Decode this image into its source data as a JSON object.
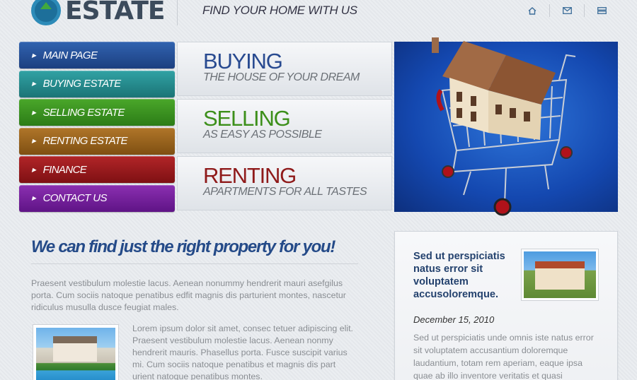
{
  "header": {
    "logo_text": "ESTATE",
    "tagline": "FIND YOUR HOME WITH US",
    "icons": [
      "home-icon",
      "mail-icon",
      "sitemap-icon"
    ]
  },
  "menu": {
    "items": [
      {
        "label": "MAIN PAGE",
        "color": "#2a569f"
      },
      {
        "label": "BUYING ESTATE",
        "color": "#279092"
      },
      {
        "label": "SELLING ESTATE",
        "color": "#3e9522"
      },
      {
        "label": "RENTING ESTATE",
        "color": "#9b651f"
      },
      {
        "label": "FINANCE",
        "color": "#9d1c1f"
      },
      {
        "label": "CONTACT US",
        "color": "#7b24a0"
      }
    ]
  },
  "promos": [
    {
      "title": "BUYING",
      "subtitle": "THE HOUSE OF YOUR DREAM",
      "color": "#284a90"
    },
    {
      "title": "SELLING",
      "subtitle": "AS EASY AS POSSIBLE",
      "color": "#3c8f1a"
    },
    {
      "title": "RENTING",
      "subtitle": "APARTMENTS FOR ALL TASTES",
      "color": "#8f1a1a"
    }
  ],
  "main": {
    "headline": "We can find just the right property for you!",
    "intro": "Praesent vestibulum molestie lacus. Aenean nonummy hendrerit mauri asefgilus porta. Cum sociis natoque penatibus edfit magnis dis parturient montes, nascetur ridiculus musulla dusce feugiat males.",
    "body": "Lorem ipsum dolor sit amet, consec tetuer adipiscing elit. Praesent vestibulum molestie lacus. Aenean nonmy hendrerit mauris. Phasellus porta. Fusce suscipit varius mi. Cum sociis natoque penatibus et magnis dis part urient natoque penatibus montes."
  },
  "news": {
    "title": "Sed ut perspiciatis natus error sit voluptatem accusoloremque.",
    "date": "December 15, 2010",
    "text": "Sed ut perspiciatis unde omnis iste natus error sit voluptatem accusantium doloremque laudantium, totam rem aperiam, eaque ipsa quae ab illo inventore veritatis et quasi"
  }
}
